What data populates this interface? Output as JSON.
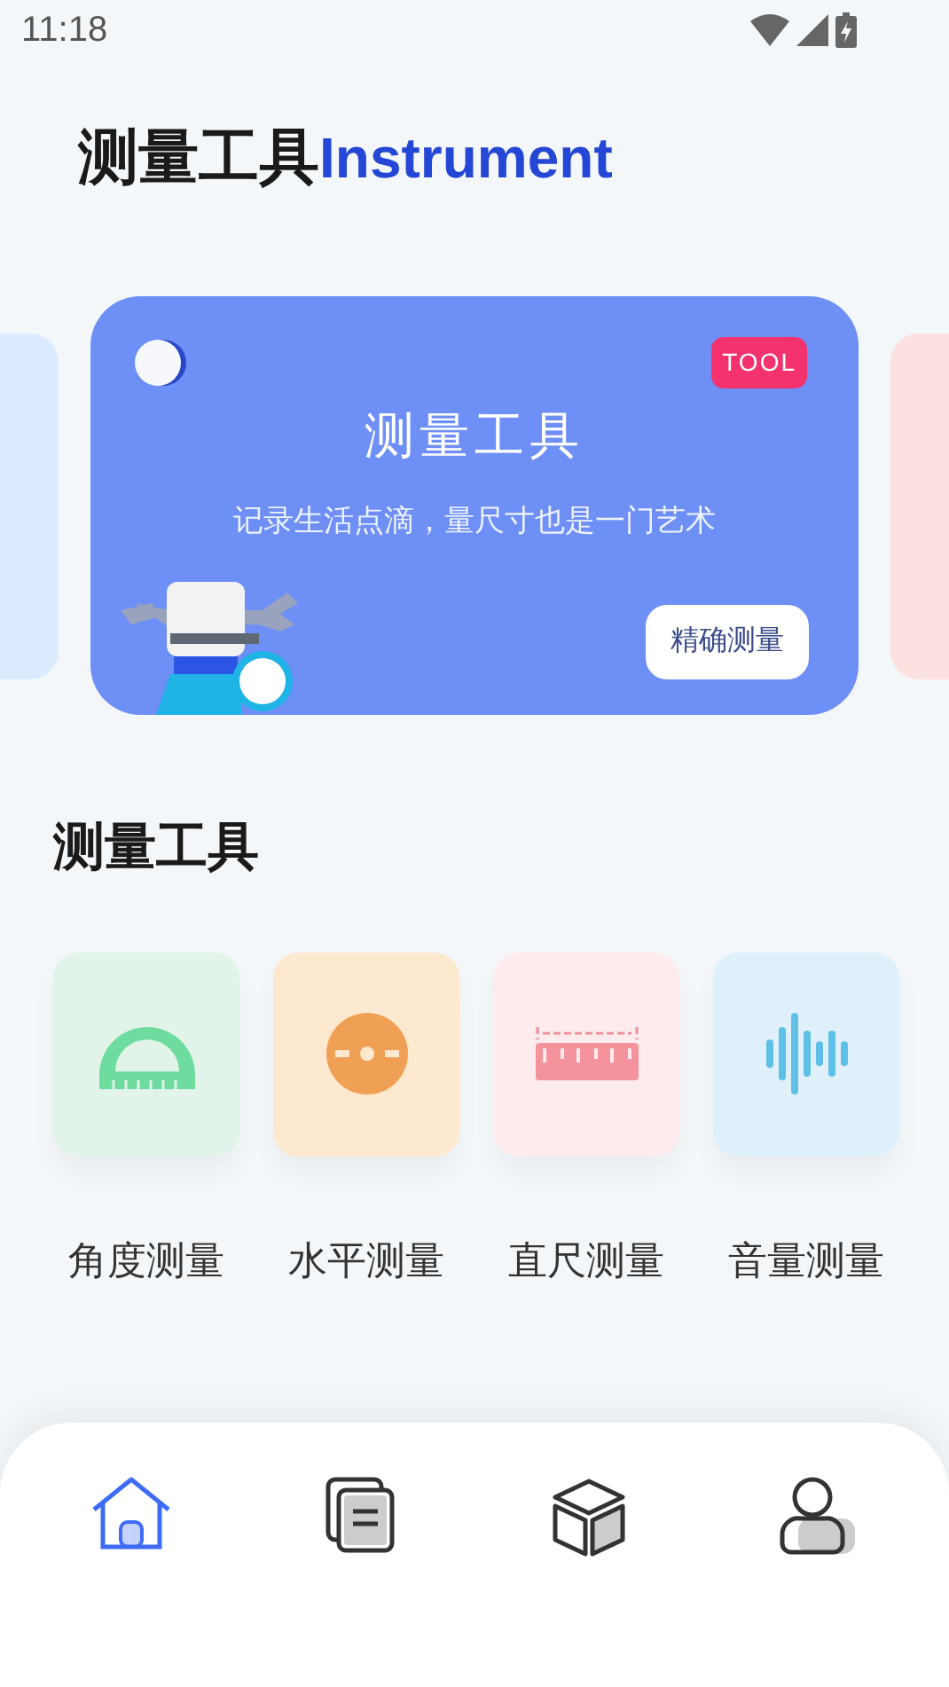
{
  "status_bar": {
    "time": "11:18"
  },
  "header": {
    "title": "测量工具",
    "subtitle": "Instrument"
  },
  "banner": {
    "badge": "TOOL",
    "title": "测量工具",
    "description": "记录生活点滴，量尺寸也是一门艺术",
    "button": "精确测量"
  },
  "section": {
    "title": "测量工具"
  },
  "tools": [
    {
      "kind": "protractor",
      "label": "角度测量",
      "color": "#e2f4ea"
    },
    {
      "kind": "level",
      "label": "水平测量",
      "color": "#fde8d0"
    },
    {
      "kind": "ruler",
      "label": "直尺测量",
      "color": "#fdebee"
    },
    {
      "kind": "sound",
      "label": "音量测量",
      "color": "#dff0fb"
    }
  ],
  "nav": [
    {
      "kind": "home",
      "selected": true
    },
    {
      "kind": "documents",
      "selected": false
    },
    {
      "kind": "cube",
      "selected": false
    },
    {
      "kind": "profile",
      "selected": false
    }
  ]
}
